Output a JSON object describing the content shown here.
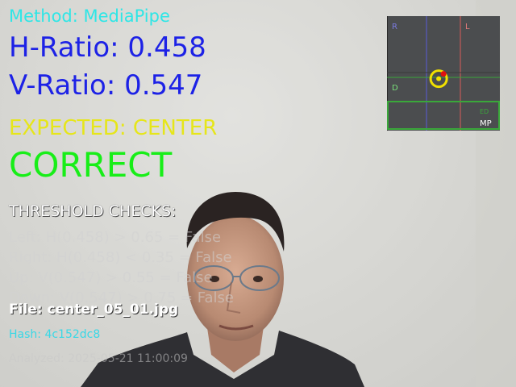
{
  "overlay": {
    "method": "Method: MediaPipe",
    "h_ratio": "H-Ratio: 0.458",
    "v_ratio": "V-Ratio: 0.547",
    "expected": "EXPECTED: CENTER",
    "verdict": "CORRECT",
    "threshold_title": "THRESHOLD CHECKS:",
    "checks": [
      "Left: H(0.458) > 0.65 = False",
      "Right: H(0.458) < 0.35 = False",
      "Up: V(0.547) > 0.55 = False",
      "Down: V(0.547) > 0.75 = False"
    ],
    "file": "File: center_05_01.jpg",
    "hash": "Hash: 4c152dc8",
    "analyzed": "Analyzed: 2025-05-21 11:00:09"
  },
  "minimap": {
    "corner_r": "R",
    "corner_l": "L",
    "corner_d": "D",
    "tag_ed": "ED",
    "tag_mp": "MP",
    "gaze": {
      "h": 0.458,
      "v": 0.547
    }
  },
  "colors": {
    "method": "#2ee6e6",
    "ratio": "#1d22e6",
    "expected": "#e6e61a",
    "verdict": "#18ee18",
    "hash": "#38d8e6",
    "zone_outline": "#3aa83a",
    "gaze_ring": "#f0e000",
    "gaze_dot": "#e01010"
  }
}
